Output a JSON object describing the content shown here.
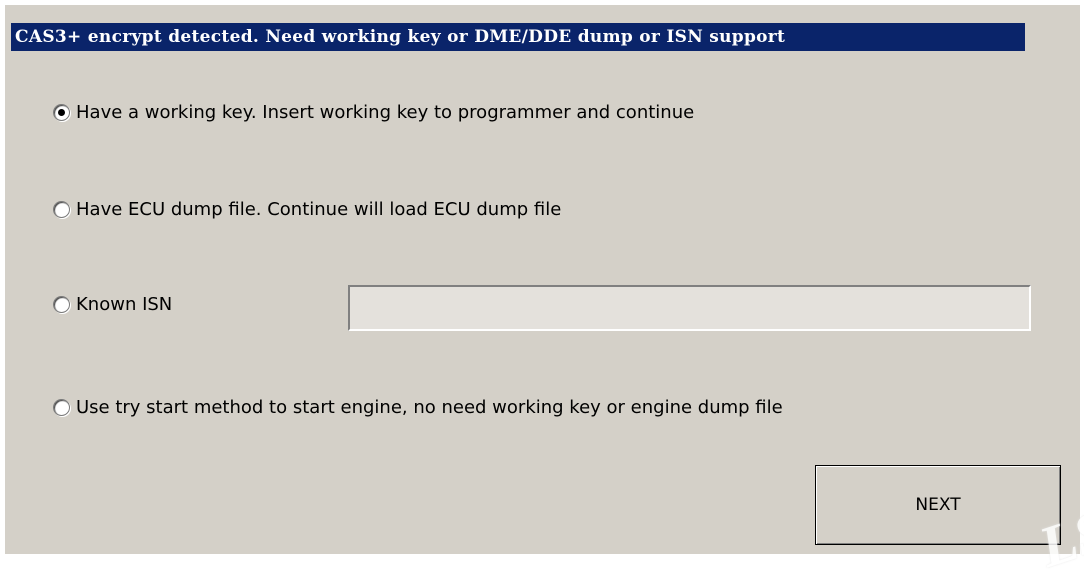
{
  "title_bar": {
    "text": "CAS3+ encrypt detected. Need working key or DME/DDE dump or ISN support",
    "background": "#0a246a",
    "text_color": "#ffffff"
  },
  "options": [
    {
      "label": "Have a working key. Insert working key to programmer and continue",
      "checked": true
    },
    {
      "label": "Have ECU dump file. Continue will load ECU dump file",
      "checked": false
    },
    {
      "label": "Known ISN",
      "checked": false
    },
    {
      "label": "Use try start method to start engine, no need working key or engine dump file",
      "checked": false
    }
  ],
  "isn_field": {
    "value": "",
    "placeholder": ""
  },
  "next_button": {
    "label": "NEXT"
  },
  "watermark": {
    "text": "LS"
  },
  "colors": {
    "dialog_background": "#d4d0c8"
  }
}
